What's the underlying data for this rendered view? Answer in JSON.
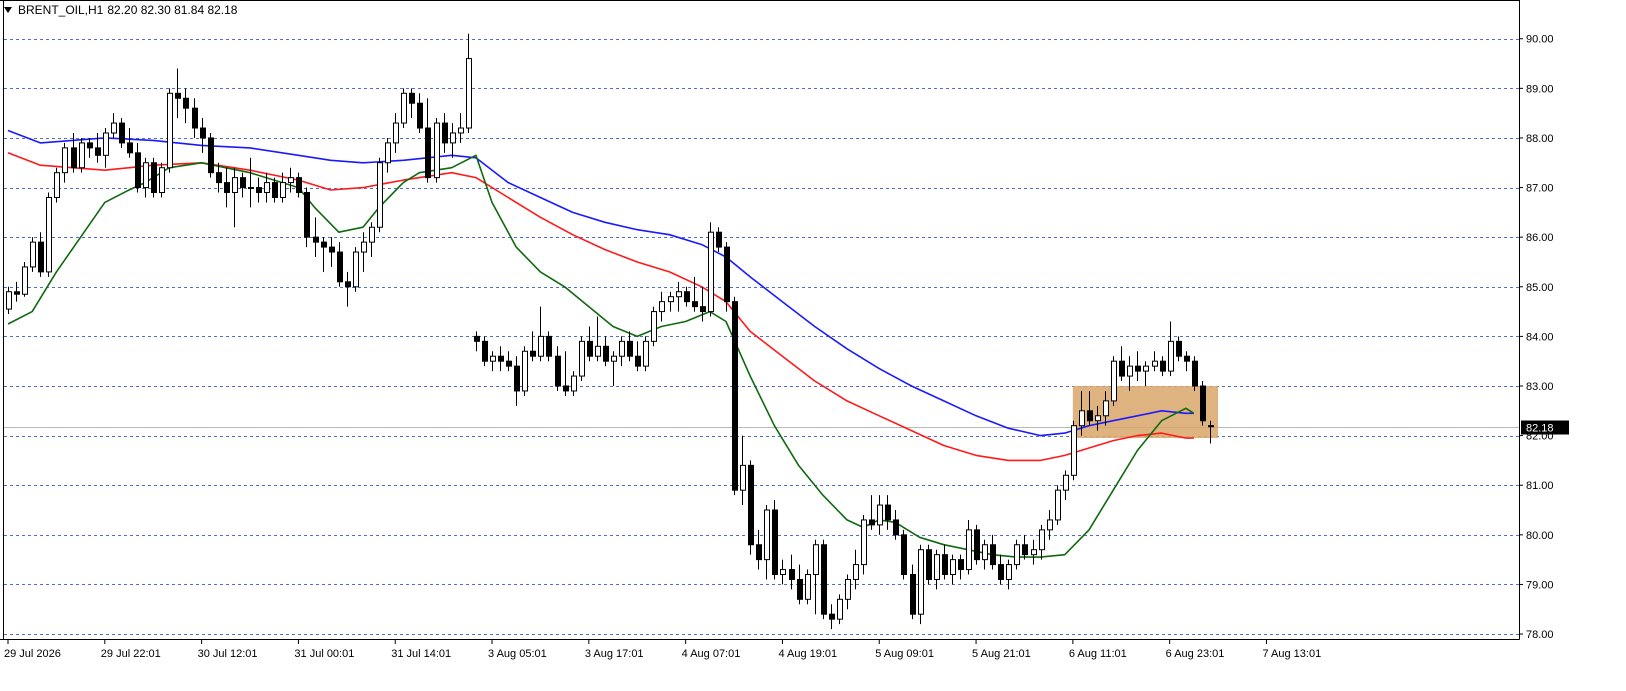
{
  "header": {
    "symbol": "BRENT_OIL,H1",
    "ohlc": "82.20 82.30 81.84 82.18"
  },
  "current_price_label": "82.18",
  "colors": {
    "background": "#ffffff",
    "grid": "#4f6fd0",
    "up_candle": "#ffffff",
    "down_candle": "#000000",
    "ma_fast": "#0f6a0f",
    "ma_mid": "#ff1a1a",
    "ma_slow": "#1a1aff",
    "zone": "#d9a66a",
    "price_tag_bg": "#000000",
    "price_tag_text": "#ffffff"
  },
  "chart_data": {
    "type": "candlestick",
    "ylim": [
      77.9,
      90.7
    ],
    "y_ticks": [
      {
        "value": 90.0,
        "label": "90.00"
      },
      {
        "value": 89.0,
        "label": "89.00"
      },
      {
        "value": 88.0,
        "label": "88.00"
      },
      {
        "value": 87.0,
        "label": "87.00"
      },
      {
        "value": 86.0,
        "label": "86.00"
      },
      {
        "value": 85.0,
        "label": "85.00"
      },
      {
        "value": 84.0,
        "label": "84.00"
      },
      {
        "value": 83.0,
        "label": "83.00"
      },
      {
        "value": 82.0,
        "label": "82.00"
      },
      {
        "value": 81.0,
        "label": "81.00"
      },
      {
        "value": 80.0,
        "label": "80.00"
      },
      {
        "value": 79.0,
        "label": "79.00"
      },
      {
        "value": 78.0,
        "label": "78.00"
      }
    ],
    "x_labels": [
      {
        "index": 0,
        "label": "29 Jul 2026"
      },
      {
        "index": 12,
        "label": "29 Jul 22:01"
      },
      {
        "index": 24,
        "label": "30 Jul 12:01"
      },
      {
        "index": 36,
        "label": "31 Jul 00:01"
      },
      {
        "index": 48,
        "label": "31 Jul 14:01"
      },
      {
        "index": 60,
        "label": "3 Aug 05:01"
      },
      {
        "index": 72,
        "label": "3 Aug 17:01"
      },
      {
        "index": 84,
        "label": "4 Aug 07:01"
      },
      {
        "index": 96,
        "label": "4 Aug 19:01"
      },
      {
        "index": 108,
        "label": "5 Aug 09:01"
      },
      {
        "index": 120,
        "label": "5 Aug 21:01"
      },
      {
        "index": 132,
        "label": "6 Aug 11:01"
      },
      {
        "index": 144,
        "label": "6 Aug 23:01"
      },
      {
        "index": 156,
        "label": "7 Aug 13:01"
      }
    ],
    "candles": [
      [
        84.55,
        85.0,
        84.45,
        84.9
      ],
      [
        84.9,
        85.1,
        84.7,
        84.85
      ],
      [
        84.85,
        85.5,
        84.8,
        85.4
      ],
      [
        85.4,
        86.0,
        85.3,
        85.9
      ],
      [
        85.9,
        86.1,
        85.2,
        85.3
      ],
      [
        85.3,
        86.9,
        85.2,
        86.8
      ],
      [
        86.8,
        87.4,
        86.7,
        87.3
      ],
      [
        87.3,
        87.9,
        87.1,
        87.8
      ],
      [
        87.8,
        88.1,
        87.3,
        87.4
      ],
      [
        87.4,
        88.0,
        87.3,
        87.9
      ],
      [
        87.9,
        88.0,
        87.6,
        87.8
      ],
      [
        87.8,
        88.1,
        87.5,
        87.65
      ],
      [
        87.65,
        88.2,
        87.4,
        88.1
      ],
      [
        88.1,
        88.5,
        88.0,
        88.3
      ],
      [
        88.3,
        88.4,
        87.8,
        87.9
      ],
      [
        87.9,
        88.2,
        87.6,
        87.7
      ],
      [
        87.7,
        87.9,
        86.9,
        87.0
      ],
      [
        87.0,
        87.6,
        86.8,
        87.5
      ],
      [
        87.5,
        87.6,
        86.8,
        86.9
      ],
      [
        86.9,
        87.5,
        86.8,
        87.4
      ],
      [
        87.4,
        89.0,
        87.3,
        88.9
      ],
      [
        88.9,
        89.4,
        88.4,
        88.8
      ],
      [
        88.8,
        89.0,
        88.3,
        88.6
      ],
      [
        88.6,
        88.8,
        88.0,
        88.2
      ],
      [
        88.2,
        88.4,
        87.7,
        88.0
      ],
      [
        88.0,
        88.1,
        87.2,
        87.3
      ],
      [
        87.3,
        87.5,
        86.9,
        87.1
      ],
      [
        87.1,
        87.4,
        86.6,
        86.9
      ],
      [
        86.9,
        87.4,
        86.2,
        87.2
      ],
      [
        87.2,
        87.3,
        86.8,
        87.0
      ],
      [
        87.0,
        87.6,
        86.6,
        87.0
      ],
      [
        87.0,
        87.2,
        86.7,
        86.9
      ],
      [
        86.9,
        87.3,
        86.7,
        87.1
      ],
      [
        87.1,
        87.2,
        86.7,
        86.8
      ],
      [
        86.8,
        87.3,
        86.7,
        87.1
      ],
      [
        87.1,
        87.4,
        86.9,
        87.2
      ],
      [
        87.2,
        87.3,
        86.8,
        86.9
      ],
      [
        86.9,
        87.0,
        85.8,
        86.0
      ],
      [
        86.0,
        86.4,
        85.6,
        85.9
      ],
      [
        85.9,
        86.0,
        85.3,
        85.8
      ],
      [
        85.8,
        86.0,
        85.4,
        85.7
      ],
      [
        85.7,
        85.9,
        85.0,
        85.1
      ],
      [
        85.1,
        85.3,
        84.6,
        85.0
      ],
      [
        85.0,
        85.8,
        84.9,
        85.7
      ],
      [
        85.7,
        86.1,
        85.3,
        85.9
      ],
      [
        85.9,
        86.3,
        85.6,
        86.2
      ],
      [
        86.2,
        87.6,
        86.1,
        87.5
      ],
      [
        87.5,
        88.0,
        87.3,
        87.9
      ],
      [
        87.9,
        88.5,
        87.7,
        88.3
      ],
      [
        88.3,
        89.0,
        88.2,
        88.9
      ],
      [
        88.9,
        89.0,
        88.4,
        88.7
      ],
      [
        88.7,
        88.9,
        88.1,
        88.2
      ],
      [
        88.2,
        88.8,
        87.1,
        87.2
      ],
      [
        87.2,
        88.4,
        87.1,
        88.3
      ],
      [
        88.3,
        88.5,
        87.7,
        87.9
      ],
      [
        87.9,
        88.3,
        87.6,
        88.1
      ],
      [
        88.1,
        88.5,
        87.9,
        88.2
      ],
      [
        88.2,
        90.1,
        88.1,
        89.6
      ],
      [
        84.0,
        84.1,
        83.7,
        83.9
      ],
      [
        83.9,
        84.0,
        83.4,
        83.5
      ],
      [
        83.5,
        83.7,
        83.3,
        83.6
      ],
      [
        83.6,
        83.8,
        83.3,
        83.5
      ],
      [
        83.5,
        83.7,
        83.3,
        83.4
      ],
      [
        83.4,
        83.6,
        82.6,
        82.9
      ],
      [
        82.9,
        83.8,
        82.8,
        83.7
      ],
      [
        83.7,
        84.1,
        83.5,
        83.6
      ],
      [
        83.6,
        84.6,
        83.5,
        84.0
      ],
      [
        84.0,
        84.1,
        83.5,
        83.6
      ],
      [
        83.6,
        83.8,
        82.9,
        83.0
      ],
      [
        83.0,
        83.7,
        82.8,
        82.9
      ],
      [
        82.9,
        83.3,
        82.8,
        83.2
      ],
      [
        83.2,
        84.0,
        83.1,
        83.9
      ],
      [
        83.9,
        84.2,
        83.5,
        83.6
      ],
      [
        83.6,
        84.4,
        83.5,
        83.8
      ],
      [
        83.8,
        84.0,
        83.4,
        83.5
      ],
      [
        83.5,
        83.7,
        83.0,
        83.6
      ],
      [
        83.6,
        84.0,
        83.4,
        83.9
      ],
      [
        83.9,
        84.1,
        83.5,
        83.6
      ],
      [
        83.6,
        83.9,
        83.3,
        83.4
      ],
      [
        83.4,
        84.0,
        83.3,
        83.9
      ],
      [
        83.9,
        84.6,
        83.8,
        84.5
      ],
      [
        84.5,
        84.9,
        84.3,
        84.7
      ],
      [
        84.7,
        84.9,
        84.5,
        84.8
      ],
      [
        84.8,
        85.1,
        84.5,
        84.9
      ],
      [
        84.9,
        85.0,
        84.6,
        84.7
      ],
      [
        84.7,
        85.2,
        84.5,
        84.6
      ],
      [
        84.6,
        85.0,
        84.3,
        84.5
      ],
      [
        84.5,
        86.3,
        84.4,
        86.1
      ],
      [
        86.1,
        86.2,
        85.7,
        85.8
      ],
      [
        85.8,
        85.9,
        84.5,
        84.7
      ],
      [
        84.7,
        84.8,
        80.8,
        80.9
      ],
      [
        80.9,
        82.0,
        80.6,
        81.4
      ],
      [
        81.4,
        81.5,
        79.6,
        79.8
      ],
      [
        79.8,
        80.1,
        79.3,
        79.5
      ],
      [
        79.5,
        80.6,
        79.1,
        80.5
      ],
      [
        80.5,
        80.7,
        79.1,
        79.2
      ],
      [
        79.2,
        79.5,
        79.0,
        79.3
      ],
      [
        79.3,
        79.6,
        78.9,
        79.1
      ],
      [
        79.1,
        79.4,
        78.6,
        78.7
      ],
      [
        78.7,
        79.3,
        78.6,
        79.2
      ],
      [
        79.2,
        79.9,
        78.4,
        79.8
      ],
      [
        79.8,
        79.9,
        78.3,
        78.4
      ],
      [
        78.4,
        78.6,
        78.1,
        78.3
      ],
      [
        78.3,
        78.8,
        78.2,
        78.7
      ],
      [
        78.7,
        79.2,
        78.5,
        79.1
      ],
      [
        79.1,
        79.7,
        78.9,
        79.4
      ],
      [
        79.4,
        80.4,
        79.2,
        80.3
      ],
      [
        80.3,
        80.8,
        80.1,
        80.2
      ],
      [
        80.2,
        80.8,
        80.0,
        80.6
      ],
      [
        80.6,
        80.8,
        80.1,
        80.3
      ],
      [
        80.3,
        80.5,
        79.9,
        80.0
      ],
      [
        80.0,
        80.1,
        79.1,
        79.2
      ],
      [
        79.2,
        79.4,
        78.3,
        78.4
      ],
      [
        78.4,
        79.8,
        78.2,
        79.7
      ],
      [
        79.7,
        79.8,
        79.0,
        79.1
      ],
      [
        79.1,
        79.7,
        78.9,
        79.6
      ],
      [
        79.6,
        79.8,
        79.1,
        79.2
      ],
      [
        79.2,
        79.6,
        79.0,
        79.5
      ],
      [
        79.5,
        79.6,
        79.1,
        79.3
      ],
      [
        79.3,
        80.3,
        79.2,
        80.1
      ],
      [
        80.1,
        80.2,
        79.4,
        79.5
      ],
      [
        79.5,
        79.9,
        79.3,
        79.8
      ],
      [
        79.8,
        80.0,
        79.3,
        79.4
      ],
      [
        79.4,
        79.6,
        79.0,
        79.1
      ],
      [
        79.1,
        79.5,
        78.9,
        79.4
      ],
      [
        79.4,
        79.9,
        79.3,
        79.8
      ],
      [
        79.8,
        80.0,
        79.5,
        79.6
      ],
      [
        79.6,
        79.9,
        79.4,
        79.7
      ],
      [
        79.7,
        80.2,
        79.5,
        80.1
      ],
      [
        80.1,
        80.5,
        79.9,
        80.3
      ],
      [
        80.3,
        81.0,
        80.2,
        80.9
      ],
      [
        80.9,
        81.3,
        80.7,
        81.2
      ],
      [
        81.2,
        82.3,
        81.1,
        82.2
      ],
      [
        82.2,
        82.9,
        82.0,
        82.5
      ],
      [
        82.5,
        82.9,
        82.2,
        82.3
      ],
      [
        82.3,
        82.6,
        82.1,
        82.4
      ],
      [
        82.4,
        82.9,
        82.2,
        82.7
      ],
      [
        82.7,
        83.6,
        82.6,
        83.5
      ],
      [
        83.5,
        83.8,
        83.1,
        83.2
      ],
      [
        83.2,
        83.6,
        82.9,
        83.4
      ],
      [
        83.4,
        83.7,
        83.1,
        83.3
      ],
      [
        83.3,
        83.5,
        83.0,
        83.4
      ],
      [
        83.4,
        83.7,
        83.3,
        83.5
      ],
      [
        83.5,
        83.6,
        83.2,
        83.3
      ],
      [
        83.3,
        84.3,
        83.2,
        83.9
      ],
      [
        83.9,
        84.0,
        83.5,
        83.6
      ],
      [
        83.6,
        83.7,
        83.3,
        83.5
      ],
      [
        83.5,
        83.6,
        82.9,
        83.0
      ],
      [
        83.0,
        83.1,
        82.2,
        82.3
      ],
      [
        82.2,
        82.3,
        81.84,
        82.18
      ]
    ],
    "ma_fast": [
      [
        0,
        84.25
      ],
      [
        3,
        84.5
      ],
      [
        6,
        85.3
      ],
      [
        9,
        86.0
      ],
      [
        12,
        86.7
      ],
      [
        15,
        86.95
      ],
      [
        17,
        87.1
      ],
      [
        20,
        87.4
      ],
      [
        24,
        87.5
      ],
      [
        30,
        87.3
      ],
      [
        36,
        87.0
      ],
      [
        38,
        86.6
      ],
      [
        41,
        86.1
      ],
      [
        44,
        86.2
      ],
      [
        46,
        86.6
      ],
      [
        49,
        87.1
      ],
      [
        51,
        87.3
      ],
      [
        55,
        87.4
      ],
      [
        58,
        87.65
      ],
      [
        60,
        86.7
      ],
      [
        63,
        85.8
      ],
      [
        66,
        85.3
      ],
      [
        69,
        85.0
      ],
      [
        72,
        84.6
      ],
      [
        75,
        84.2
      ],
      [
        78,
        84.0
      ],
      [
        81,
        84.2
      ],
      [
        84,
        84.3
      ],
      [
        87,
        84.5
      ],
      [
        89,
        84.3
      ],
      [
        92,
        83.2
      ],
      [
        95,
        82.2
      ],
      [
        98,
        81.4
      ],
      [
        101,
        80.8
      ],
      [
        104,
        80.3
      ],
      [
        106,
        80.15
      ],
      [
        108,
        80.3
      ],
      [
        110,
        80.25
      ],
      [
        113,
        79.95
      ],
      [
        116,
        79.8
      ],
      [
        119,
        79.7
      ],
      [
        122,
        79.6
      ],
      [
        125,
        79.55
      ],
      [
        128,
        79.55
      ],
      [
        131,
        79.6
      ],
      [
        134,
        80.1
      ],
      [
        137,
        80.9
      ],
      [
        140,
        81.7
      ],
      [
        143,
        82.3
      ],
      [
        146,
        82.55
      ],
      [
        147,
        82.45
      ]
    ],
    "ma_mid": [
      [
        0,
        87.7
      ],
      [
        4,
        87.45
      ],
      [
        8,
        87.4
      ],
      [
        12,
        87.35
      ],
      [
        18,
        87.45
      ],
      [
        24,
        87.5
      ],
      [
        30,
        87.35
      ],
      [
        36,
        87.15
      ],
      [
        40,
        86.95
      ],
      [
        44,
        87.0
      ],
      [
        49,
        87.15
      ],
      [
        55,
        87.3
      ],
      [
        58,
        87.2
      ],
      [
        62,
        86.8
      ],
      [
        66,
        86.4
      ],
      [
        70,
        86.05
      ],
      [
        74,
        85.75
      ],
      [
        78,
        85.5
      ],
      [
        82,
        85.3
      ],
      [
        86,
        85.0
      ],
      [
        89,
        84.7
      ],
      [
        92,
        84.1
      ],
      [
        96,
        83.6
      ],
      [
        100,
        83.1
      ],
      [
        104,
        82.7
      ],
      [
        108,
        82.4
      ],
      [
        112,
        82.1
      ],
      [
        116,
        81.8
      ],
      [
        120,
        81.6
      ],
      [
        124,
        81.5
      ],
      [
        128,
        81.5
      ],
      [
        131,
        81.6
      ],
      [
        134,
        81.75
      ],
      [
        137,
        81.9
      ],
      [
        140,
        82.0
      ],
      [
        143,
        82.05
      ],
      [
        146,
        81.95
      ],
      [
        147,
        81.95
      ]
    ],
    "ma_slow": [
      [
        0,
        88.15
      ],
      [
        4,
        87.9
      ],
      [
        8,
        87.95
      ],
      [
        12,
        88.0
      ],
      [
        18,
        87.95
      ],
      [
        24,
        87.85
      ],
      [
        30,
        87.8
      ],
      [
        36,
        87.65
      ],
      [
        40,
        87.55
      ],
      [
        44,
        87.5
      ],
      [
        49,
        87.55
      ],
      [
        55,
        87.65
      ],
      [
        58,
        87.6
      ],
      [
        62,
        87.1
      ],
      [
        66,
        86.8
      ],
      [
        70,
        86.5
      ],
      [
        74,
        86.3
      ],
      [
        78,
        86.15
      ],
      [
        82,
        86.05
      ],
      [
        86,
        85.85
      ],
      [
        89,
        85.6
      ],
      [
        92,
        85.2
      ],
      [
        96,
        84.7
      ],
      [
        100,
        84.2
      ],
      [
        104,
        83.75
      ],
      [
        108,
        83.35
      ],
      [
        112,
        83.0
      ],
      [
        116,
        82.7
      ],
      [
        120,
        82.4
      ],
      [
        124,
        82.15
      ],
      [
        128,
        82.0
      ],
      [
        131,
        82.05
      ],
      [
        134,
        82.2
      ],
      [
        137,
        82.3
      ],
      [
        140,
        82.4
      ],
      [
        143,
        82.5
      ],
      [
        146,
        82.45
      ],
      [
        147,
        82.45
      ]
    ],
    "zone": {
      "x_start_index": 132,
      "x_end_index": 150,
      "y_top": 83.0,
      "y_bottom": 81.95
    },
    "current_price": 82.18
  }
}
